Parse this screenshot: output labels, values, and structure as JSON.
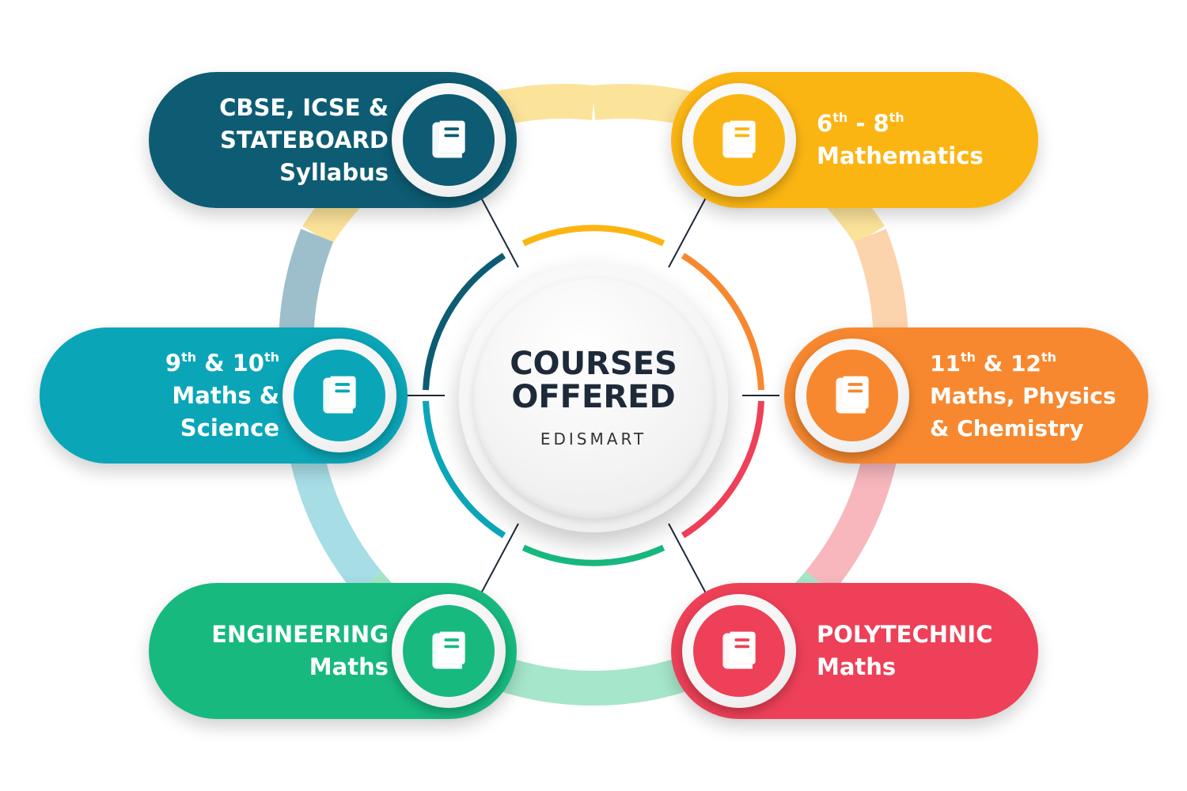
{
  "center": {
    "title_line1": "COURSES",
    "title_line2": "OFFERED",
    "subtitle": "EDISMART"
  },
  "icon": "book-icon",
  "colors": {
    "dark_teal": "#0d5c73",
    "teal": "#0aa6b8",
    "green": "#17b97f",
    "yellow": "#fbb513",
    "orange": "#f7882f",
    "red": "#ee4058"
  },
  "courses": [
    {
      "id": "cbse",
      "lines": [
        "CBSE, ICSE &",
        "STATEBOARD",
        "Syllabus"
      ]
    },
    {
      "id": "grade-6-8",
      "line1": {
        "a": "6",
        "a_sup": "th",
        "sep": " - ",
        "b": "8",
        "b_sup": "th"
      },
      "line2": "Mathematics"
    },
    {
      "id": "grade-9-10",
      "line1": {
        "a": "9",
        "a_sup": "th",
        "sep": " & ",
        "b": "10",
        "b_sup": "th"
      },
      "line2": "Maths &",
      "line3": "Science"
    },
    {
      "id": "grade-11-12",
      "line1": {
        "a": "11",
        "a_sup": "th",
        "sep": " & ",
        "b": "12",
        "b_sup": "th"
      },
      "line2": "Maths, Physics",
      "line3": "& Chemistry"
    },
    {
      "id": "engineering",
      "lines": [
        "ENGINEERING",
        "Maths"
      ]
    },
    {
      "id": "polytechnic",
      "lines": [
        "POLYTECHNIC",
        "Maths"
      ]
    }
  ]
}
